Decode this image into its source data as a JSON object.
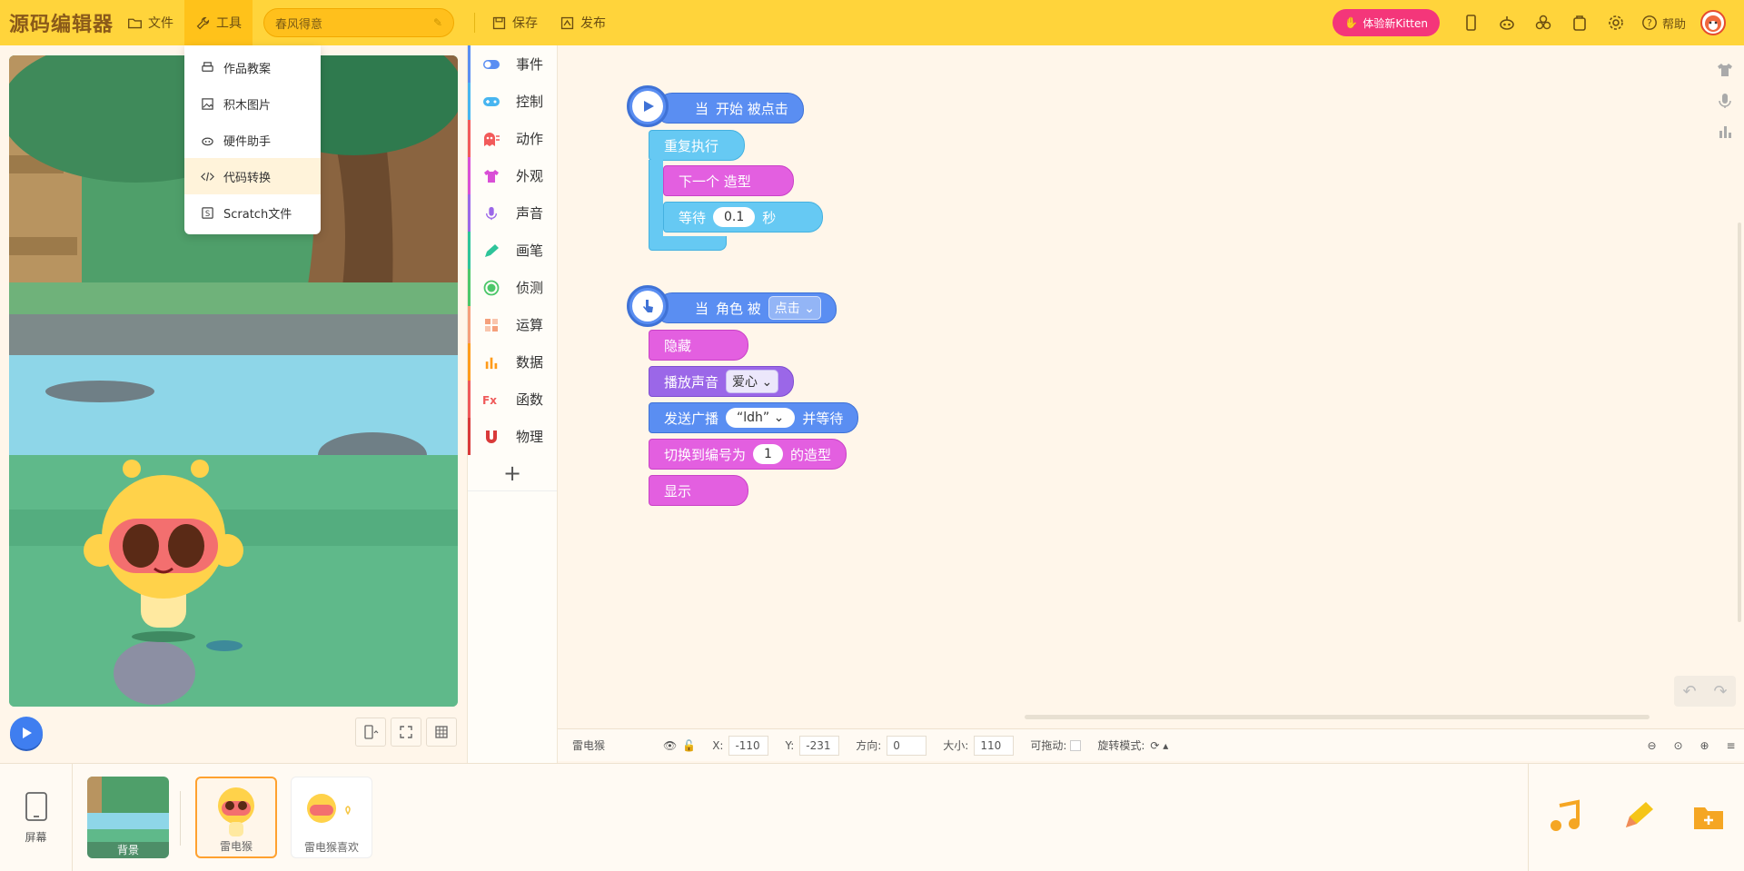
{
  "app": {
    "logo_text": "源码编辑器"
  },
  "topbar": {
    "file_label": "文件",
    "tools_label": "工具",
    "project_name": "春风得意",
    "save_label": "保存",
    "publish_label": "发布",
    "kitten_label": "体验新Kitten",
    "help_label": "帮助"
  },
  "tools_menu": {
    "items": [
      {
        "label": "作品教案",
        "icon": "printer-icon"
      },
      {
        "label": "积木图片",
        "icon": "image-icon"
      },
      {
        "label": "硬件助手",
        "icon": "robot-icon"
      },
      {
        "label": "代码转换",
        "icon": "code-icon"
      },
      {
        "label": "Scratch文件",
        "icon": "scratch-file-icon"
      }
    ],
    "highlighted_index": 3
  },
  "categories": [
    {
      "label": "事件",
      "color": "#5a8ef2",
      "icon": "toggle-icon"
    },
    {
      "label": "控制",
      "color": "#47b5f0",
      "icon": "gamepad-icon"
    },
    {
      "label": "动作",
      "color": "#f25a5a",
      "icon": "ghost-icon"
    },
    {
      "label": "外观",
      "color": "#d94fd6",
      "icon": "shirt-icon"
    },
    {
      "label": "声音",
      "color": "#9b67e8",
      "icon": "mic-icon"
    },
    {
      "label": "画笔",
      "color": "#2ec49a",
      "icon": "pen-icon"
    },
    {
      "label": "侦测",
      "color": "#4cc76a",
      "icon": "target-icon"
    },
    {
      "label": "运算",
      "color": "#f5a07c",
      "icon": "calc-icon"
    },
    {
      "label": "数据",
      "color": "#ff9b1a",
      "icon": "bar-chart-icon"
    },
    {
      "label": "函数",
      "color": "#ef5a5a",
      "icon": "function-icon"
    },
    {
      "label": "物理",
      "color": "#d93a3a",
      "icon": "magnet-icon"
    }
  ],
  "scripts": {
    "script1": {
      "hat_prefix": "当",
      "hat_text": "开始 被点击",
      "repeat_label": "重复执行",
      "next_costume_label": "下一个 造型",
      "wait_label": "等待",
      "wait_value": "0.1",
      "wait_unit": "秒"
    },
    "script2": {
      "hat_prefix": "当",
      "hat_text": "角色 被",
      "hat_dropdown": "点击",
      "hide_label": "隐藏",
      "play_sound_label": "播放声音",
      "sound_value": "爱心",
      "broadcast_label": "发送广播",
      "broadcast_value": "“ldh”",
      "broadcast_suffix": "并等待",
      "switch_label": "切换到编号为",
      "switch_value": "1",
      "switch_suffix": "的造型",
      "show_label": "显示"
    }
  },
  "props": {
    "sprite_name": "雷电猴",
    "x_label": "X:",
    "x_value": "-110",
    "y_label": "Y:",
    "y_value": "-231",
    "direction_label": "方向:",
    "direction_value": "0",
    "size_label": "大小:",
    "size_value": "110",
    "draggable_label": "可拖动:",
    "rotation_label": "旋转模式:"
  },
  "bottom": {
    "screen_label": "屏幕",
    "background_label": "背景",
    "sprites": [
      {
        "label": "雷电猴",
        "selected": true
      },
      {
        "label": "雷电猴喜欢",
        "selected": false
      }
    ]
  },
  "colors": {
    "topbar": "#ffd43b",
    "accent_pink": "#f4367a",
    "event_blue": "#5a8ef2"
  }
}
